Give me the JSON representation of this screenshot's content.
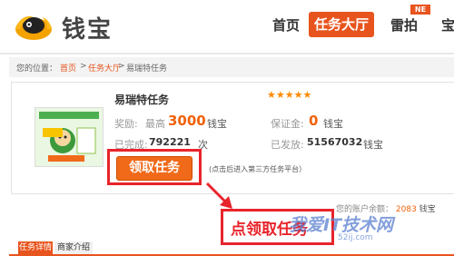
{
  "header": {
    "logo_text": "钱宝",
    "nav": [
      "首页",
      "任务大厅",
      "雷拍",
      "宝"
    ],
    "badge": "NE",
    "colors": {
      "accent": "#e8541e"
    }
  },
  "breadcrumb": {
    "prefix": "您的位置：",
    "items": [
      "首页",
      "任务大厅",
      "易瑞特任务"
    ],
    "separator": ">"
  },
  "task": {
    "title": "易瑞特任务",
    "stars": "★★★★★",
    "reward_label": "奖励:",
    "reward_prefix": "最高",
    "reward_value": "3000",
    "reward_unit": "钱宝",
    "deposit_label": "保证金:",
    "deposit_value": "0",
    "deposit_unit": "钱宝",
    "done_label": "已完成:",
    "done_value": "792221",
    "done_unit": "次",
    "paid_label": "已发放:",
    "paid_value": "51567032",
    "paid_unit": "钱宝",
    "claim_button": "领取任务",
    "hint": "(点击后进入第三方任务平台）",
    "icon": "task-thumbnail"
  },
  "account": {
    "balance_label": "您的账户余额：",
    "balance_value": "2083",
    "balance_unit": "钱宝"
  },
  "annotation": {
    "callout": "点领取任务"
  },
  "watermark": {
    "text": "我爱IT技术网",
    "sub": "52ij.com"
  },
  "tabs": [
    "任务详情",
    "商家介绍"
  ]
}
